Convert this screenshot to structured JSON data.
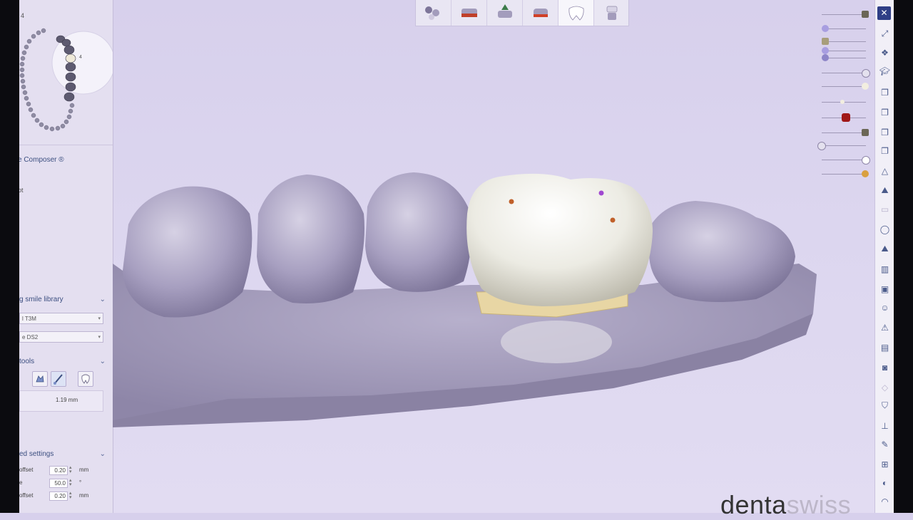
{
  "left_panel": {
    "top_tag": "4",
    "composer_label": "e Composer ®",
    "top_small": "pt",
    "library_header": "g smile library",
    "library_select_1": "l T3M",
    "library_select_2": "e DS2",
    "tools_header": "tools",
    "distance_value": "1.19 mm",
    "settings_header": "ed settings",
    "settings": [
      {
        "label": "offset",
        "value": "0.20",
        "unit": "mm"
      },
      {
        "label": "e",
        "value": "50.0",
        "unit": "°"
      },
      {
        "label": "offset",
        "value": "0.20",
        "unit": "mm"
      }
    ]
  },
  "top_toolbar": {
    "buttons": [
      {
        "name": "articulation-icon"
      },
      {
        "name": "crown-design-icon"
      },
      {
        "name": "margin-line-icon"
      },
      {
        "name": "insertion-icon"
      },
      {
        "name": "tooth-icon",
        "active": true
      },
      {
        "name": "connector-icon"
      }
    ]
  },
  "watermark": {
    "part1": "denta",
    "part2": "swiss"
  },
  "close_icon": "✕"
}
